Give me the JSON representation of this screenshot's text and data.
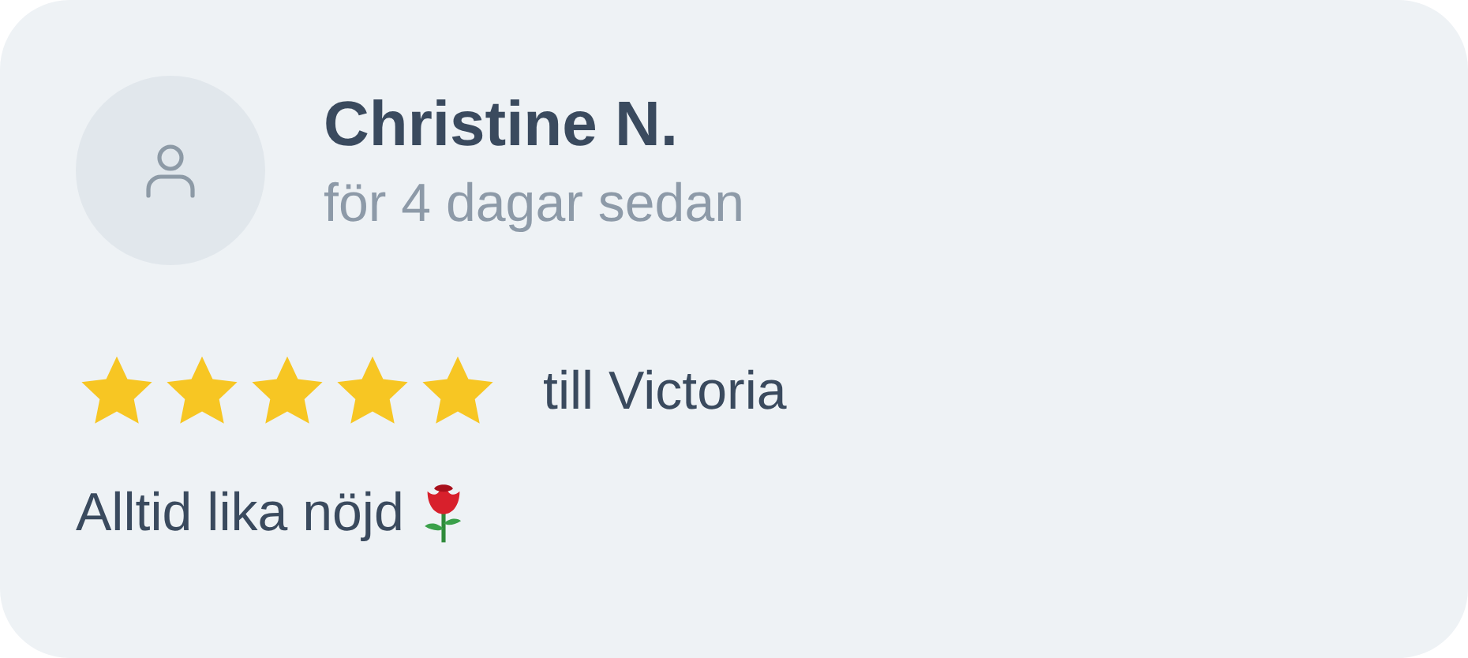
{
  "review": {
    "author": "Christine N.",
    "time": "för 4 dagar sedan",
    "stars": 5,
    "recipient": "till Victoria",
    "text": "Alltid lika nöjd"
  }
}
